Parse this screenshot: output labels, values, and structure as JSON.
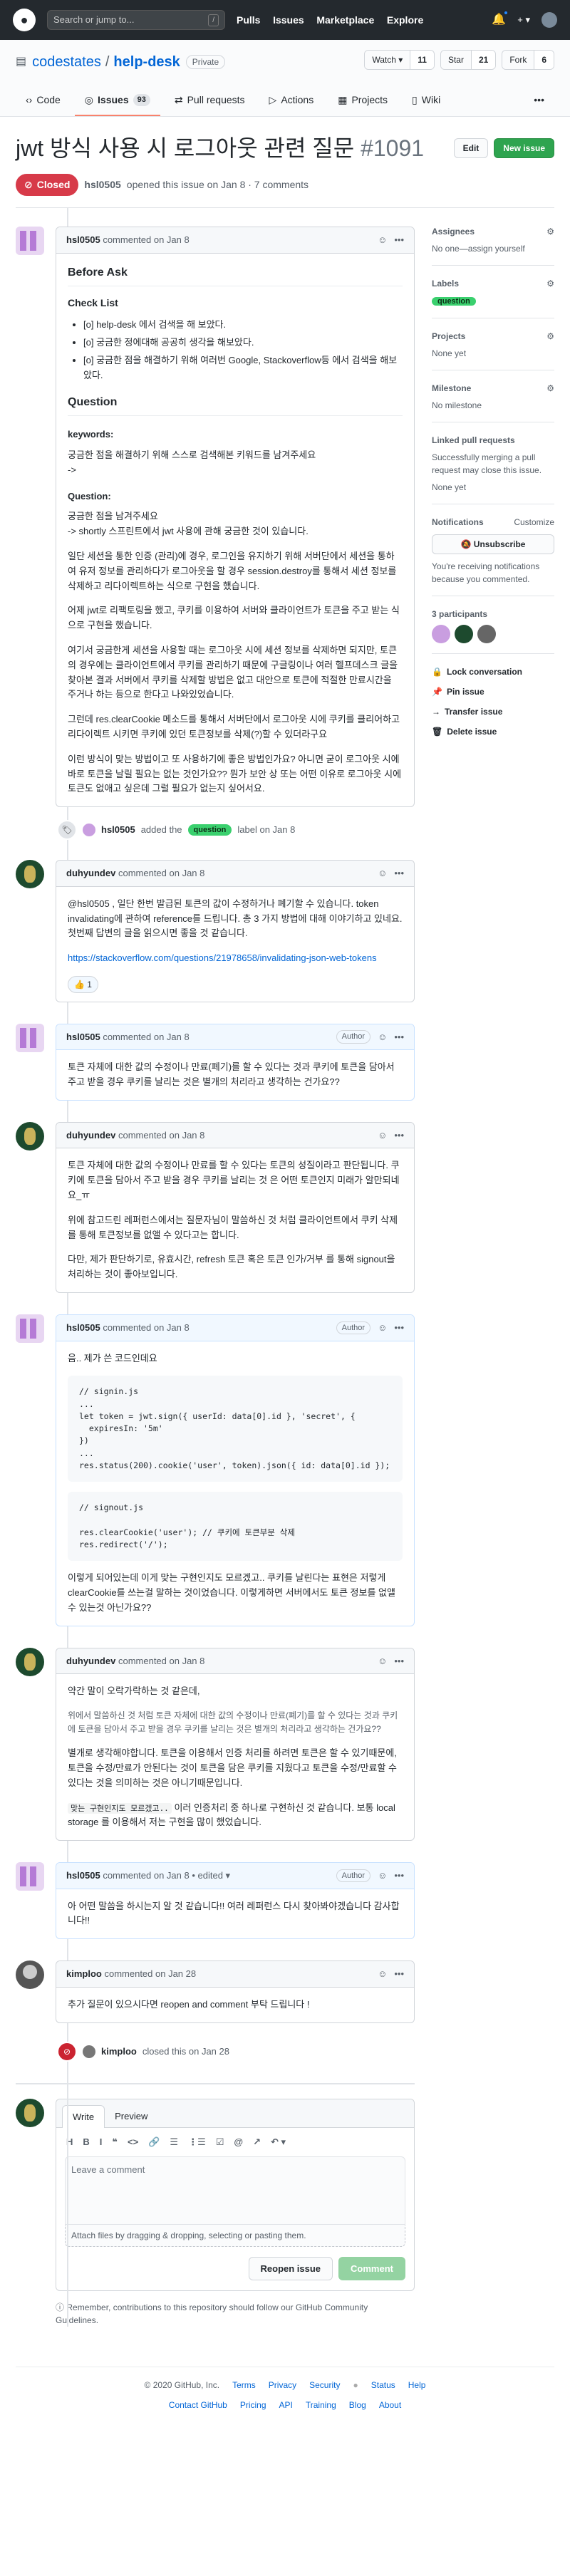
{
  "topbar": {
    "search_placeholder": "Search or jump to...",
    "search_key": "/",
    "nav": [
      "Pulls",
      "Issues",
      "Marketplace",
      "Explore"
    ],
    "plus": "+ ▾"
  },
  "repo": {
    "owner": "codestates",
    "name": "help-desk",
    "visibility": "Private",
    "watch_label": "Watch ▾",
    "watch_count": "11",
    "star_label": "Star",
    "star_count": "21",
    "fork_label": "Fork",
    "fork_count": "6"
  },
  "tabs": [
    {
      "label": "Code"
    },
    {
      "label": "Issues",
      "count": "93"
    },
    {
      "label": "Pull requests"
    },
    {
      "label": "Actions"
    },
    {
      "label": "Projects"
    },
    {
      "label": "Wiki"
    }
  ],
  "tabs_more": "•••",
  "issue": {
    "title": "jwt 방식 사용 시 로그아웃 관련 질문",
    "number": "#1091",
    "edit": "Edit",
    "new_issue": "New issue",
    "state": "Closed",
    "opener": "hsl0505",
    "meta": "opened this issue on Jan 8 · 7 comments"
  },
  "comments": [
    {
      "user": "hsl0505",
      "when": "commented on Jan 8",
      "h2": "Before Ask",
      "h3": "Check List",
      "checks": [
        "[o] help-desk 에서 검색을 해 보았다.",
        "[o] 궁금한 정에대해 공공히 생각을 해보았다.",
        "[o] 궁금한 점을 해결하기 위해 여러번 Google, Stackoverflow등 에서 검색을 해보았다."
      ],
      "q_title": "Question",
      "kw_label": "keywords:",
      "kw_text": "궁금한 점을 해결하기 위해 스스로 검색해본 키워드를 남겨주세요",
      "kw_value": "-> shortly 스프린트에서 jwt 사용에 관해 궁금한 것이 있습니다.",
      "question_label": "Question:",
      "question_text": "궁금한 점을 남겨주세요",
      "paras": [
        "일단 세션을 통한 인증 (관리)에 경우, 로그인을 유지하기 위해 서버단에서 세션을 통하여 유저 정보를 관리하다가 로그아웃을 할 경우 session.destroy를 통해서 세션 정보를 삭제하고 리다이렉트하는 식으로 구현을 했습니다.",
        "어제 jwt로 리팩토링을 했고, 쿠키를 이용하여 서버와 클라이언트가 토큰을 주고 받는 식으로 구현을 했습니다.",
        "여기서 궁금한게 세션을 사용할 때는 로그아웃 시에 세션 정보를 삭제하면 되지만, 토큰의 경우에는 클라이언트에서 쿠키를 관리하기 때문에 구글링이나 여러 헬프데스크 글을 찾아본 결과 서버에서 쿠키를 삭제할 방법은 없고 대안으로 토큰에 적절한 만료시간을 주거나 하는 등으로 한다고 나와있었습니다.",
        "그런데 res.clearCookie 메소드를 통해서 서버단에서 로그아웃 시에 쿠키를 클리어하고 리다이렉트 시키면 쿠키에 있던 토큰정보를 삭제(?)할 수 있더라구요",
        "이런 방식이 맞는 방법이고 또 사용하기에 좋은 방법인가요? 아니면 굳이 로그아웃 시에 바로 토큰을 날릴 필요는 없는 것인가요?? 뭔가 보안 상 또는 어떤 이유로 로그아웃 시에 토큰도 없애고 싶은데 그럴 필요가 없는지 싶어서요."
      ]
    },
    {
      "user": "duhyundev",
      "when": "commented on Jan 8",
      "p1": "@hsl0505 , 일단 한번 발급된 토큰의 값이 수정하거나 폐기할 수 있습니다. token invalidating에 관하여 reference를 드립니다. 총 3 가지 방법에 대해 이야기하고 있네요. 첫번째 답변의 글을 읽으시면 좋을 것 같습니다.",
      "link": "https://stackoverflow.com/questions/21978658/invalidating-json-web-tokens",
      "reaction": "👍 1"
    },
    {
      "user": "hsl0505",
      "when": "commented on Jan 8",
      "role": "Author",
      "p1": "토큰 자체에 대한 값의 수정이나 만료(폐기)를 할 수 있다는 것과 쿠키에 토큰을 담아서 주고 받을 경우 쿠키를 날리는 것은 별개의 처리라고 생각하는 건가요??"
    },
    {
      "user": "duhyundev",
      "when": "commented on Jan 8",
      "paras": [
        "토큰 자체에 대한 값의 수정이나 만료를 할 수 있다는 토큰의 성질이라고 판단됩니다. 쿠키에 토큰을 담아서 주고 받을 경우 쿠키를 날리는 것 은 어떤 토큰인지 미래가 알만되네요_ㅠ",
        "위에 참고드린 레퍼런스에서는 질문자님이 말씀하신 것 처럼 클라이언트에서 쿠키 삭제 를 통해 토큰정보를 없앨 수 있다고는 합니다.",
        "다만, 제가 판단하기로, 유효시간, refresh 토큰 혹은 토큰 인가/거부 를 통해 signout을 처리하는 것이 좋아보입니다."
      ]
    },
    {
      "user": "hsl0505",
      "when": "commented on Jan 8",
      "role": "Author",
      "intro": "음.. 제가 쓴 코드인데요",
      "code1": "// signin.js\n...\nlet token = jwt.sign({ userId: data[0].id }, 'secret', {\n  expiresIn: '5m'\n})\n...\nres.status(200).cookie('user', token).json({ id: data[0].id });",
      "code2": "// signout.js\n\nres.clearCookie('user'); // 쿠키에 토큰부분 삭제\nres.redirect('/');",
      "outro": "이렇게 되어있는데 이게 맞는 구현인지도 모르겠고.. 쿠키를 날린다는 표현은 저렇게 clearCookie를 쓰는걸 말하는 것이었습니다. 이렇게하면 서버에서도 토큰 정보를 없앨 수 있는것 아닌가요??"
    },
    {
      "user": "duhyundev",
      "when": "commented on Jan 8",
      "p1": "약간 말이 오락가락하는 것 같은데,",
      "quote": "위에서 말씀하신 것 처럼 토큰 자체에 대한 값의 수정이나 만료(폐기)를 할 수 있다는 것과 쿠키에 토큰을 담아서 주고 받을 경우 쿠키를 날리는 것은 별개의 처리라고 생각하는 건가요??",
      "p2": "별개로 생각해야합니다. 토큰을 이용해서 인증 처리를 하려면 토큰은 할 수 있기때문에, 토큰을 수정/만료가 안된다는 것이 토큰을 담은 쿠키를 지웠다고 토큰을 수정/만료할 수 있다는 것을 의미하는 것은 아니기때문입니다.",
      "p3_code": "맞는 구현인지도 모르겠고..",
      "p3": "이러 인증처리 중 하나로 구현하신 것 같습니다. 보통 local storage 를 이용해서 저는 구현을 많이 했었습니다."
    },
    {
      "user": "hsl0505",
      "when": "commented on Jan 8 • edited ▾",
      "role": "Author",
      "p1": "아 어떤 말씀을 하시는지 알 것 같습니다!! 여러 레퍼런스 다시 찾아봐야겠습니다 감사합니다!!"
    },
    {
      "user": "kimploo",
      "when": "commented on Jan 28",
      "p1": "추가 질문이 있으시다면 reopen and comment 부탁 드립니다 !"
    }
  ],
  "label_event": {
    "actor": "hsl0505",
    "text": "added the",
    "label": "question",
    "suffix": "label on Jan 8"
  },
  "close_event": {
    "actor": "kimploo",
    "text": "closed this on Jan 28"
  },
  "sidebar": {
    "assignees_title": "Assignees",
    "assignees_value": "No one—assign yourself",
    "labels_title": "Labels",
    "label": "question",
    "projects_title": "Projects",
    "projects_value": "None yet",
    "milestone_title": "Milestone",
    "milestone_value": "No milestone",
    "linked_title": "Linked pull requests",
    "linked_desc": "Successfully merging a pull request may close this issue.",
    "linked_value": "None yet",
    "notif_title": "Notifications",
    "customize": "Customize",
    "unsubscribe": "🔕 Unsubscribe",
    "notif_desc": "You're receiving notifications because you commented.",
    "participants": "3 participants",
    "actions": [
      "Lock conversation",
      "Pin issue",
      "Transfer issue",
      "Delete issue"
    ]
  },
  "editor": {
    "write": "Write",
    "preview": "Preview",
    "tools": [
      "H",
      "B",
      "I",
      "❝",
      "<>",
      "🔗",
      "☰",
      "⋮☰",
      "☑",
      "@",
      "↗",
      "↶ ▾"
    ],
    "placeholder": "Leave a comment",
    "attach": "Attach files by dragging & dropping, selecting or pasting them.",
    "reopen": "Reopen issue",
    "comment": "Comment"
  },
  "tip": "Remember, contributions to this repository should follow our GitHub Community Guidelines.",
  "footer": {
    "row1": [
      "© 2020 GitHub, Inc.",
      "Terms",
      "Privacy",
      "Security",
      "Status",
      "Help"
    ],
    "row2": [
      "Contact GitHub",
      "Pricing",
      "API",
      "Training",
      "Blog",
      "About"
    ]
  },
  "colors": {
    "closed": "#d73a49",
    "label_question": "#3ad06e",
    "topbar": "#24292e"
  }
}
